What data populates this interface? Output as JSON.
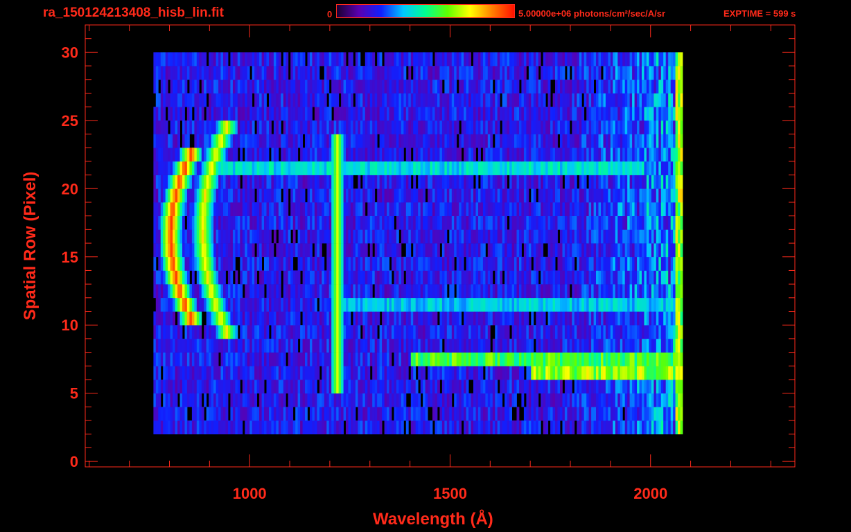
{
  "header": {
    "filename": "ra_150124213408_hisb_lin.fit",
    "colorbar_min_label": "0",
    "colorbar_max_label": "5.00000e+06 photons/cm²/sec/A/sr",
    "exptime_label": "EXPTIME = 599 s"
  },
  "colors": {
    "text": "#ff2a1a",
    "axes": "#ff2a1a",
    "background": "#000000",
    "colormap": [
      "#1a0030",
      "#5a00b0",
      "#1020ff",
      "#00c8ff",
      "#00ff90",
      "#60ff00",
      "#ffff00",
      "#ff8000",
      "#ff1000"
    ]
  },
  "chart_data": {
    "type": "heatmap",
    "title": "ra_150124213408_hisb_lin.fit",
    "xlabel": "Wavelength (Å)",
    "ylabel": "Spatial Row (Pixel)",
    "xlim": [
      590,
      2360
    ],
    "ylim": [
      -0.4,
      32
    ],
    "xticks": [
      1000,
      1500,
      2000
    ],
    "xtick_labels": [
      "1000",
      "1500",
      "2000"
    ],
    "yticks": [
      0,
      5,
      10,
      15,
      20,
      25,
      30
    ],
    "ytick_labels": [
      "0",
      "5",
      "10",
      "15",
      "20",
      "25",
      "30"
    ],
    "colorbar": {
      "min": 0,
      "max": 5000000,
      "units": "photons/cm²/sec/A/sr"
    },
    "data_extent": {
      "x": [
        760,
        2080
      ],
      "y": [
        2,
        30
      ]
    },
    "features": [
      {
        "type": "arc",
        "x_center": 800,
        "y_center": 16.5,
        "y_halfwidth": 6.5,
        "level": 0.95
      },
      {
        "type": "arc",
        "x_center": 880,
        "y_center": 17,
        "y_halfwidth": 7.5,
        "level": 0.75
      },
      {
        "type": "line",
        "x": 1216,
        "y_range": [
          5,
          24
        ],
        "level": 0.72
      },
      {
        "type": "band",
        "y": 21.5,
        "x_range": [
          900,
          1980
        ],
        "level": 0.45
      },
      {
        "type": "band",
        "y": 11.5,
        "x_range": [
          1200,
          2060
        ],
        "level": 0.42
      },
      {
        "type": "band",
        "y": 7.5,
        "x_range": [
          1400,
          2070
        ],
        "level": 0.62
      },
      {
        "type": "band",
        "y": 6.5,
        "x_range": [
          1700,
          2075
        ],
        "level": 0.7
      }
    ]
  }
}
